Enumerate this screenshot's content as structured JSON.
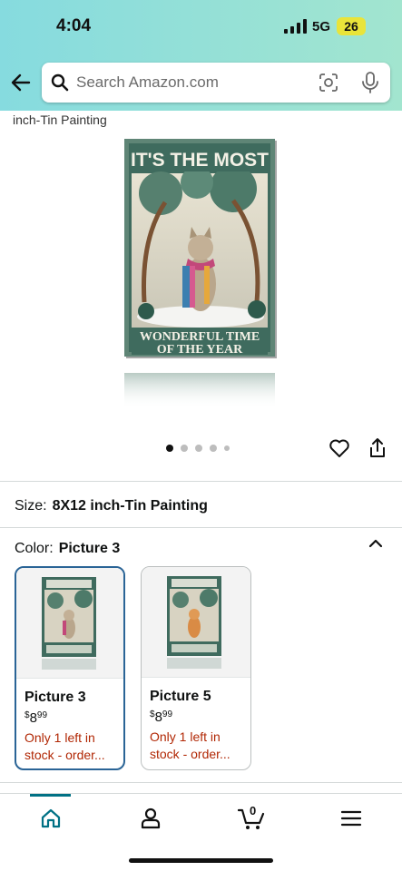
{
  "status_bar": {
    "time": "4:04",
    "network": "5G",
    "battery": "26"
  },
  "search": {
    "placeholder": "Search Amazon.com"
  },
  "breadcrumb": "inch-Tin Painting",
  "product_image": {
    "headline": "IT'S THE MOST",
    "footer_line1": "WONDERFUL TIME",
    "footer_line2": "OF THE YEAR"
  },
  "carousel": {
    "total": 5,
    "active_index": 0
  },
  "size": {
    "label": "Size:",
    "value": "8X12 inch-Tin Painting"
  },
  "color": {
    "label": "Color:",
    "value": "Picture 3"
  },
  "swatches": [
    {
      "name": "Picture 3",
      "currency": "$",
      "price_whole": "8",
      "price_cents": "99",
      "stock": "Only 1 left in stock - order..."
    },
    {
      "name": "Picture 5",
      "currency": "$",
      "price_whole": "8",
      "price_cents": "99",
      "stock": "Only 1 left in stock - order..."
    }
  ],
  "nav": {
    "cart_count": "0"
  },
  "colors": {
    "accent": "#007185",
    "stock_red": "#b12704",
    "selected_border": "#2a6496"
  }
}
